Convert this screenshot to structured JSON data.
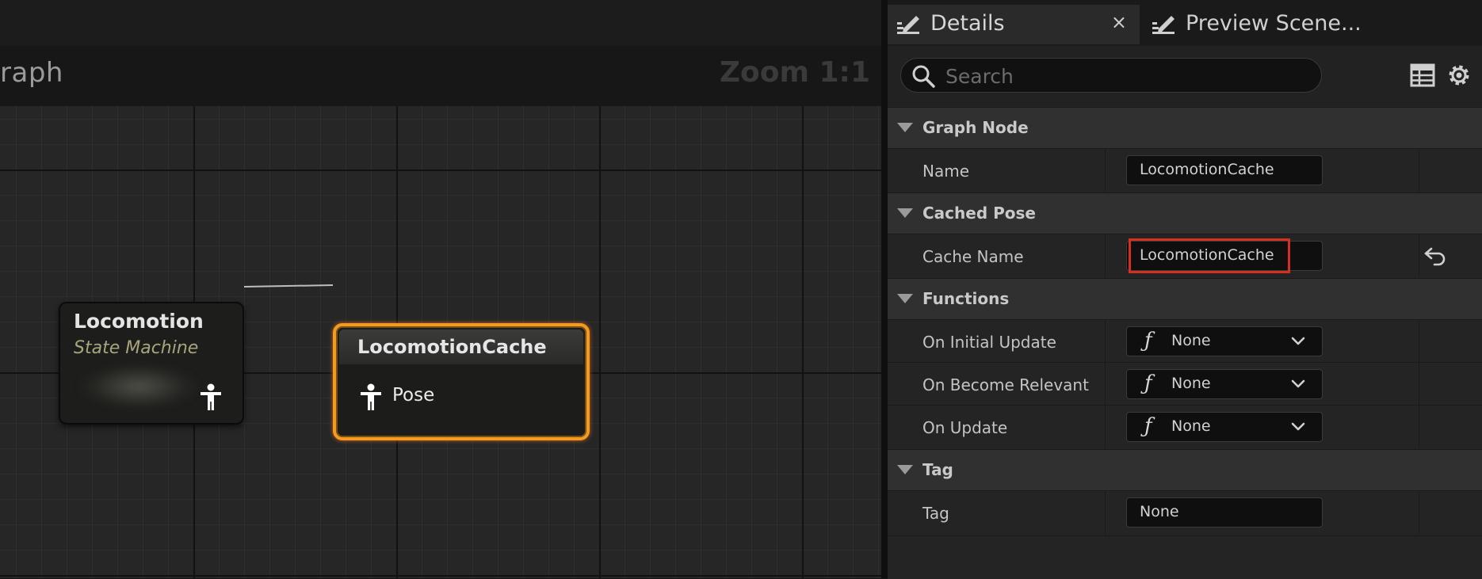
{
  "graph": {
    "title": "raph",
    "zoom": "Zoom 1:1",
    "nodes": {
      "locomotion": {
        "title": "Locomotion",
        "subtitle": "State Machine"
      },
      "cache": {
        "title": "LocomotionCache",
        "pin_label": "Pose"
      }
    }
  },
  "details": {
    "tabs": [
      {
        "label": "Details",
        "close": "×"
      },
      {
        "label": "Preview Scene..."
      }
    ],
    "search": {
      "placeholder": "Search",
      "value": ""
    },
    "sections": {
      "graph_node": {
        "label": "Graph Node",
        "rows": {
          "name": {
            "label": "Name",
            "value": "LocomotionCache"
          }
        }
      },
      "cached_pose": {
        "label": "Cached Pose",
        "rows": {
          "cache_name": {
            "label": "Cache Name",
            "value": "LocomotionCache"
          }
        }
      },
      "functions": {
        "label": "Functions",
        "rows": {
          "on_initial_update": {
            "label": "On Initial Update",
            "value": "None"
          },
          "on_become_relevant": {
            "label": "On Become Relevant",
            "value": "None"
          },
          "on_update": {
            "label": "On Update",
            "value": "None"
          }
        }
      },
      "tag": {
        "label": "Tag",
        "rows": {
          "tag": {
            "label": "Tag",
            "value": "None"
          }
        }
      }
    }
  },
  "icons": {
    "tab_details": "pencil-icon",
    "tab_preview": "pencil-icon",
    "search": "search-icon",
    "table_view": "table-icon",
    "settings": "gear-icon",
    "pose_pin": "person-icon",
    "reset": "reset-arrow-icon",
    "function": "function-icon",
    "dropdown": "chevron-down-icon"
  },
  "colors": {
    "selection_outline": "#f39a22",
    "highlight_box": "#d4301f",
    "subtitle": "#a8a57c"
  }
}
